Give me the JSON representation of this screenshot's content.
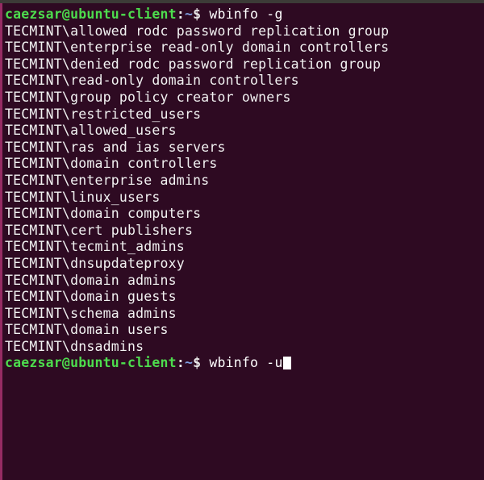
{
  "window": {
    "app": "Terminal",
    "background_color": "#2e0a22",
    "titlebar_color": "#3c3b37",
    "edge_accent_color": "#a8326e",
    "foreground_color": "#ffffff",
    "prompt_user_color": "#4ddc4d",
    "prompt_path_color": "#7f9fe0",
    "cursor_color": "#ffffff"
  },
  "session": {
    "prompt_user_host": "caezsar@ubuntu-client",
    "prompt_colon": ":",
    "prompt_path": "~",
    "prompt_symbol": "$",
    "first_command": "wbinfo -g",
    "second_command": "wbinfo -u"
  },
  "output": {
    "lines": [
      "TECMINT\\allowed rodc password replication group",
      "TECMINT\\enterprise read-only domain controllers",
      "TECMINT\\denied rodc password replication group",
      "TECMINT\\read-only domain controllers",
      "TECMINT\\group policy creator owners",
      "TECMINT\\restricted_users",
      "TECMINT\\allowed_users",
      "TECMINT\\ras and ias servers",
      "TECMINT\\domain controllers",
      "TECMINT\\enterprise admins",
      "TECMINT\\linux_users",
      "TECMINT\\domain computers",
      "TECMINT\\cert publishers",
      "TECMINT\\tecmint_admins",
      "TECMINT\\dnsupdateproxy",
      "TECMINT\\domain admins",
      "TECMINT\\domain guests",
      "TECMINT\\schema admins",
      "TECMINT\\domain users",
      "TECMINT\\dnsadmins"
    ]
  }
}
